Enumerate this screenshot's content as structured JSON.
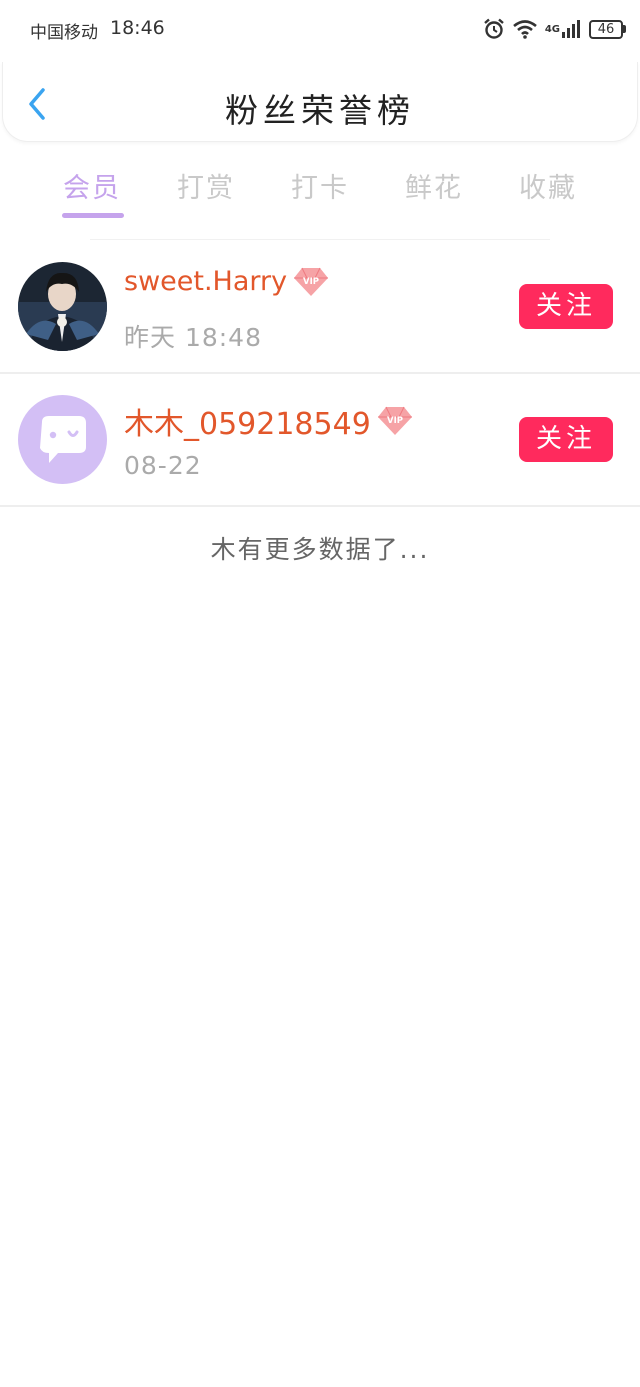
{
  "status_bar": {
    "carrier": "中国移动",
    "time": "18:46",
    "network": "4G",
    "battery": "46"
  },
  "header": {
    "title": "粉丝荣誉榜",
    "back_icon": "chevron-left-icon"
  },
  "tabs": [
    {
      "label": "会员",
      "active": true
    },
    {
      "label": "打赏",
      "active": false
    },
    {
      "label": "打卡",
      "active": false
    },
    {
      "label": "鲜花",
      "active": false
    },
    {
      "label": "收藏",
      "active": false
    }
  ],
  "fans": [
    {
      "username": "sweet.Harry",
      "badge": "VIP",
      "date": "昨天  18:48",
      "follow_label": "关注"
    },
    {
      "username": "木木_059218549",
      "badge": "VIP",
      "date": "08-22",
      "follow_label": "关注"
    }
  ],
  "footer": {
    "no_more": "木有更多数据了..."
  },
  "colors": {
    "accent": "#c5a3ec",
    "username": "#e2572b",
    "follow_button": "#ff2a5d",
    "back_icon": "#3aa4f0",
    "default_avatar": "#d3bff5"
  }
}
